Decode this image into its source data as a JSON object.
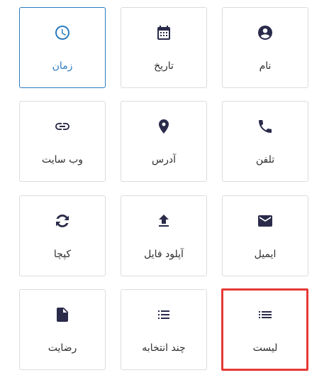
{
  "fields": [
    {
      "id": "name",
      "label": "نام",
      "icon": "account-circle-icon"
    },
    {
      "id": "date",
      "label": "تاریخ",
      "icon": "calendar-icon"
    },
    {
      "id": "time",
      "label": "زمان",
      "icon": "clock-icon"
    },
    {
      "id": "phone",
      "label": "تلفن",
      "icon": "phone-icon"
    },
    {
      "id": "address",
      "label": "آدرس",
      "icon": "location-pin-icon"
    },
    {
      "id": "website",
      "label": "وب سایت",
      "icon": "link-icon"
    },
    {
      "id": "email",
      "label": "ایمیل",
      "icon": "envelope-icon"
    },
    {
      "id": "upload",
      "label": "آپلود فایل",
      "icon": "upload-icon"
    },
    {
      "id": "captcha",
      "label": "کپچا",
      "icon": "captcha-icon"
    },
    {
      "id": "list",
      "label": "لیست",
      "icon": "list-icon"
    },
    {
      "id": "multichoice",
      "label": "چند انتخابه",
      "icon": "checklist-icon"
    },
    {
      "id": "consent",
      "label": "رضایت",
      "icon": "document-icon"
    }
  ],
  "selected": "time",
  "highlighted": "list",
  "colors": {
    "active": "#2a7bbf",
    "icon": "#2a2a4a",
    "highlight": "#e53935",
    "border": "#dcdcdc"
  }
}
